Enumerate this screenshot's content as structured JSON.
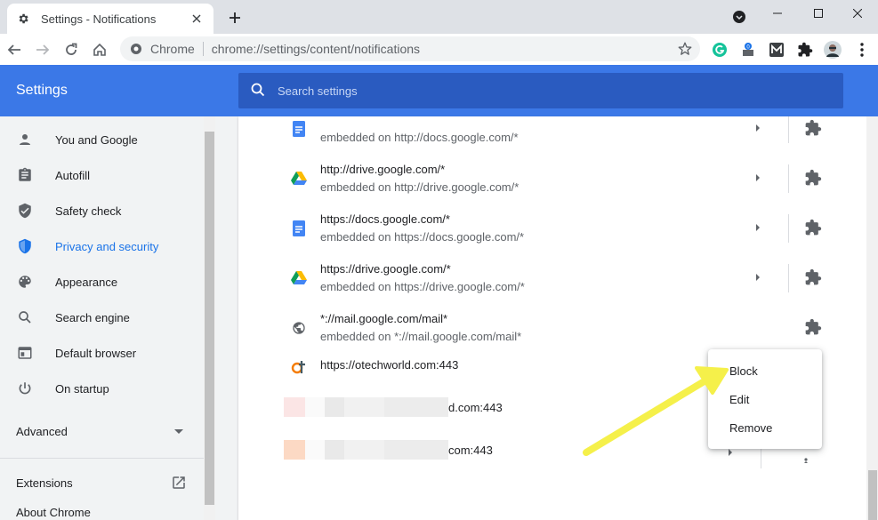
{
  "browser": {
    "tab": {
      "title": "Settings - Notifications",
      "icon": "gear-icon"
    },
    "omnibox": {
      "chip": "Chrome",
      "url": "chrome://settings/content/notifications"
    }
  },
  "settings": {
    "title": "Settings",
    "search_placeholder": "Search settings"
  },
  "sidebar": {
    "items": [
      {
        "label": "You and Google",
        "icon": "person-icon"
      },
      {
        "label": "Autofill",
        "icon": "clipboard-icon"
      },
      {
        "label": "Safety check",
        "icon": "shield-check-icon"
      },
      {
        "label": "Privacy and security",
        "icon": "shield-icon",
        "active": true
      },
      {
        "label": "Appearance",
        "icon": "palette-icon"
      },
      {
        "label": "Search engine",
        "icon": "search-icon"
      },
      {
        "label": "Default browser",
        "icon": "browser-icon"
      },
      {
        "label": "On startup",
        "icon": "power-icon"
      }
    ],
    "advanced": "Advanced",
    "extensions": "Extensions",
    "about": "About Chrome"
  },
  "sites": [
    {
      "origin": "",
      "embedded": "embedded on http://docs.google.com/*",
      "favicon": "docs-icon"
    },
    {
      "origin": "http://drive.google.com/*",
      "embedded": "embedded on http://drive.google.com/*",
      "favicon": "drive-icon"
    },
    {
      "origin": "https://docs.google.com/*",
      "embedded": "embedded on https://docs.google.com/*",
      "favicon": "docs-icon"
    },
    {
      "origin": "https://drive.google.com/*",
      "embedded": "embedded on https://drive.google.com/*",
      "favicon": "drive-icon"
    },
    {
      "origin": "*://mail.google.com/mail*",
      "embedded": "embedded on *://mail.google.com/mail*",
      "favicon": "globe-icon"
    },
    {
      "origin": "https://otechworld.com:443",
      "embedded": "",
      "favicon": "otechworld-icon"
    },
    {
      "origin": "d.com:443",
      "embedded": "",
      "favicon": ""
    },
    {
      "origin": "com:443",
      "embedded": "",
      "favicon": ""
    }
  ],
  "context_menu": {
    "items": [
      "Block",
      "Edit",
      "Remove"
    ]
  },
  "colors": {
    "header": "#3b78e7",
    "search": "#2a5bc0",
    "accent": "#1a73e8",
    "annotation_arrow": "#f5f04a"
  }
}
